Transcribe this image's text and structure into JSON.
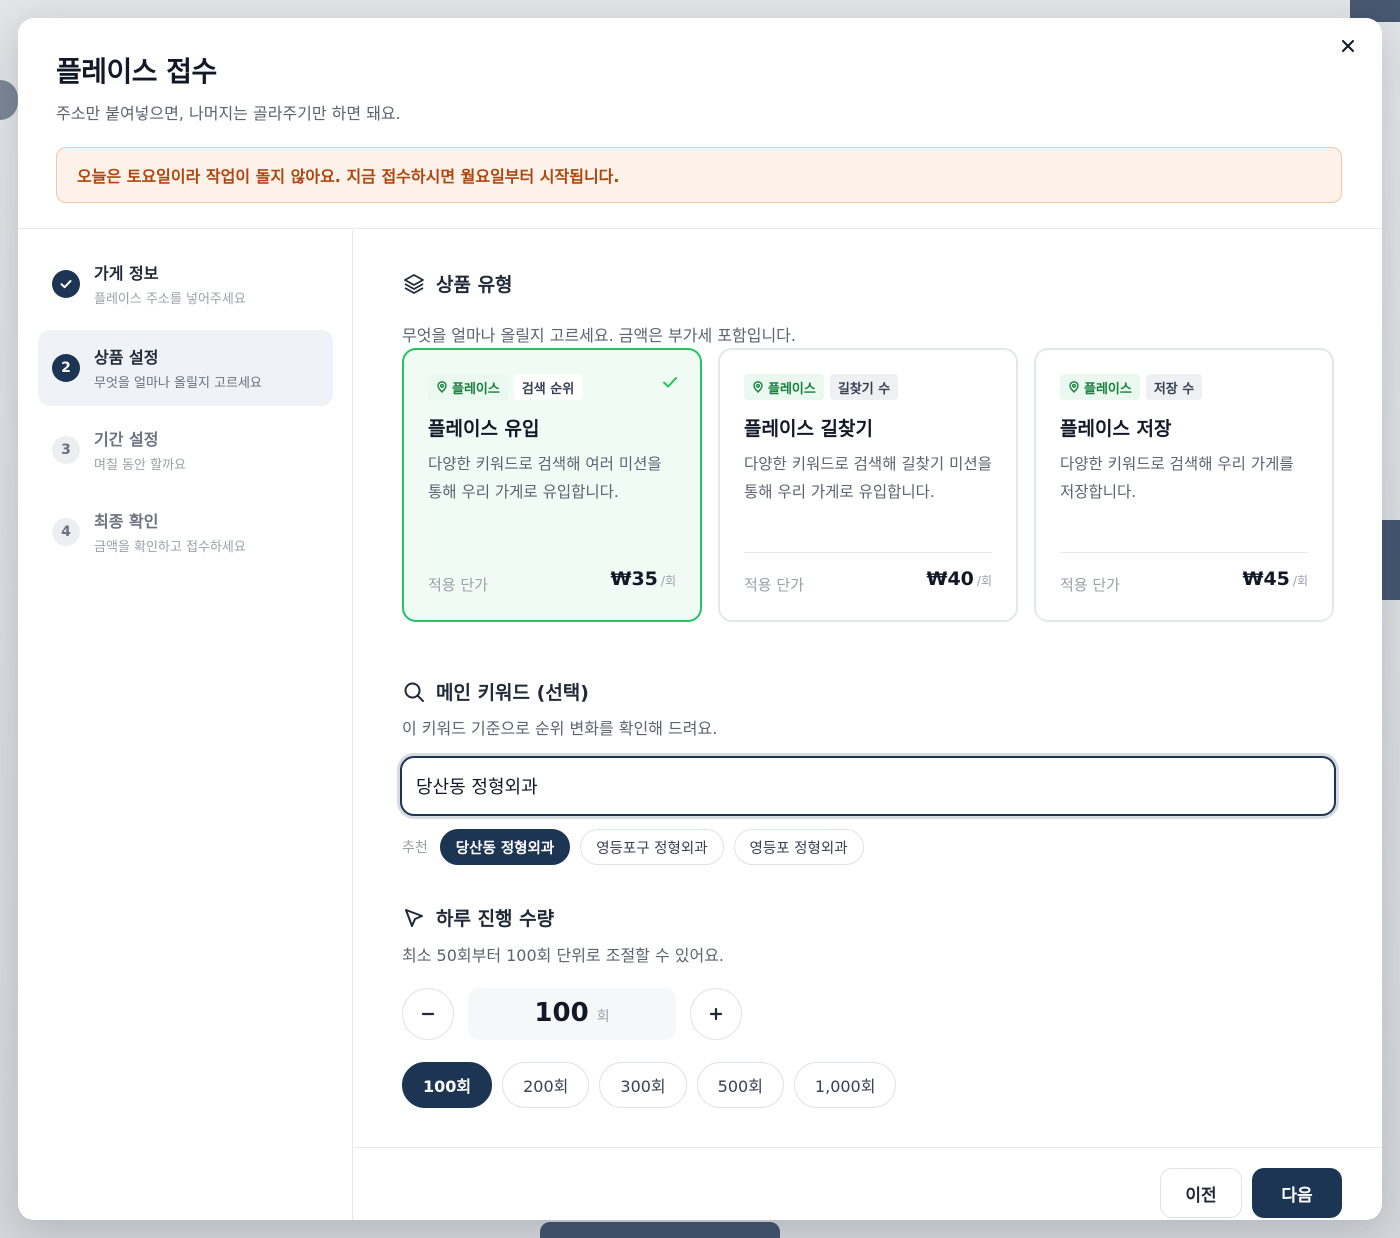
{
  "modal": {
    "title": "플레이스 접수",
    "subtitle": "주소만 붙여넣으면, 나머지는 골라주기만 하면 돼요.",
    "notice": "오늘은 토요일이라 작업이 돌지 않아요. 지금 접수하시면 월요일부터 시작됩니다."
  },
  "steps": [
    {
      "number": "1",
      "title": "가게 정보",
      "desc": "플레이스 주소를 넣어주세요",
      "state": "done"
    },
    {
      "number": "2",
      "title": "상품 설정",
      "desc": "무엇을 얼마나 올릴지 고르세요",
      "state": "current"
    },
    {
      "number": "3",
      "title": "기간 설정",
      "desc": "며칠 동안 할까요",
      "state": "todo"
    },
    {
      "number": "4",
      "title": "최종 확인",
      "desc": "금액을 확인하고 접수하세요",
      "state": "todo"
    }
  ],
  "product": {
    "title": "상품 유형",
    "desc": "무엇을 얼마나 올릴지 고르세요. 금액은 부가세 포함입니다.",
    "cards": [
      {
        "tag1": "플레이스",
        "tag2": "검색 순위",
        "title": "플레이스 유입",
        "desc": "다양한 키워드로 검색해 여러 미션을 통해 우리 가게로 유입합니다.",
        "price_label": "적용 단가",
        "price": "₩35",
        "unit": "/회",
        "selected": true
      },
      {
        "tag1": "플레이스",
        "tag2": "길찾기 수",
        "title": "플레이스 길찾기",
        "desc": "다양한 키워드로 검색해 길찾기 미션을 통해 우리 가게로 유입합니다.",
        "price_label": "적용 단가",
        "price": "₩40",
        "unit": "/회",
        "selected": false
      },
      {
        "tag1": "플레이스",
        "tag2": "저장 수",
        "title": "플레이스 저장",
        "desc": "다양한 키워드로 검색해 우리 가게를 저장합니다.",
        "price_label": "적용 단가",
        "price": "₩45",
        "unit": "/회",
        "selected": false
      }
    ]
  },
  "keyword": {
    "title": "메인 키워드 (선택)",
    "desc": "이 키워드 기준으로 순위 변화를 확인해 드려요.",
    "value": "당산동 정형외과",
    "rec_label": "추천",
    "recommendations": [
      "당산동 정형외과",
      "영등포구 정형외과",
      "영등포 정형외과"
    ]
  },
  "daily": {
    "title": "하루 진행 수량",
    "desc": "최소 50회부터 100회 단위로 조절할 수 있어요.",
    "count": "100",
    "unit": "회",
    "presets": [
      "100회",
      "200회",
      "300회",
      "500회",
      "1,000회"
    ]
  },
  "footer": {
    "prev_label": "이전",
    "next_label": "다음"
  },
  "colors": {
    "primary": "#1c3553",
    "accent_green": "#22c55e",
    "notice_text": "#b0460f"
  }
}
